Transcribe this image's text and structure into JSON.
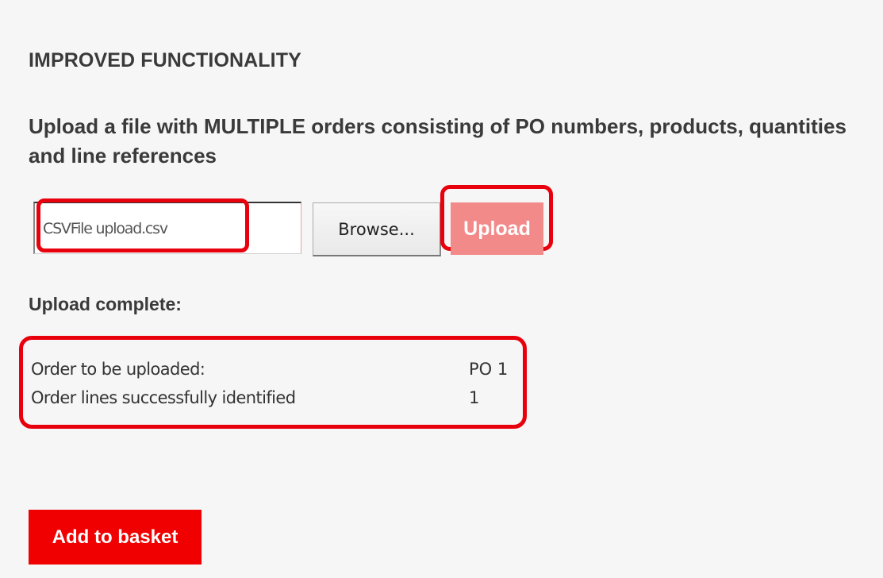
{
  "section": {
    "heading": "IMPROVED FUNCTIONALITY",
    "description": "Upload a file with MULTIPLE orders consisting of PO numbers, products, quantities and line references"
  },
  "upload_form": {
    "file_input_value": "CSVFile upload.csv",
    "browse_label": "Browse...",
    "upload_label": "Upload"
  },
  "result": {
    "status_label": "Upload complete:",
    "rows": [
      {
        "label": "Order to be uploaded:",
        "value": "PO 1"
      },
      {
        "label": "Order lines successfully identified",
        "value": "1"
      }
    ]
  },
  "actions": {
    "add_to_basket_label": "Add to basket"
  },
  "colors": {
    "highlight": "#e8000d",
    "upload_button": "#f28a8a",
    "basket_button": "#f00000",
    "panel_background": "#f6f6f6"
  }
}
